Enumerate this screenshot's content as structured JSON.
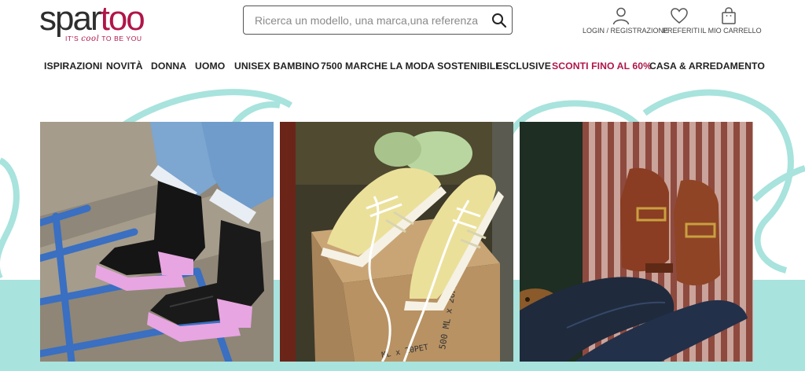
{
  "header": {
    "logo": {
      "part1": "spar",
      "part2": "too",
      "tagline_prefix": "IT'S ",
      "tagline_cool": "cool",
      "tagline_suffix": " TO BE YOU"
    },
    "search": {
      "placeholder": "Ricerca un modello, una marca,una referenza",
      "value": ""
    },
    "login_label": "LOGIN / REGISTRAZIONE",
    "favorites_label": "PREFERITI",
    "cart_label": "IL MIO CARRELLO"
  },
  "nav": {
    "items": [
      {
        "label": "ISPIRAZIONI"
      },
      {
        "label": "NOVITÀ"
      },
      {
        "label": "DONNA"
      },
      {
        "label": "UOMO"
      },
      {
        "label": "UNISEX BAMBINO"
      },
      {
        "label": "7500 MARCHE"
      },
      {
        "label": "LA MODA SOSTENIBILE"
      },
      {
        "label": "ESCLUSIVE"
      },
      {
        "label": "SCONTI FINO AL 60%"
      },
      {
        "label": "CASA & ARREDAMENTO"
      }
    ]
  },
  "hero": {
    "panels": [
      {
        "icon": "boots-photo"
      },
      {
        "icon": "sneakers-photo"
      },
      {
        "icon": "loafers-photo"
      }
    ],
    "box_text_1": "500 ML x 20PET",
    "box_text_2": "ML x 20PET"
  },
  "colors": {
    "brand": "#b0154a",
    "teal": "#a8e3dd",
    "text": "#222222"
  }
}
